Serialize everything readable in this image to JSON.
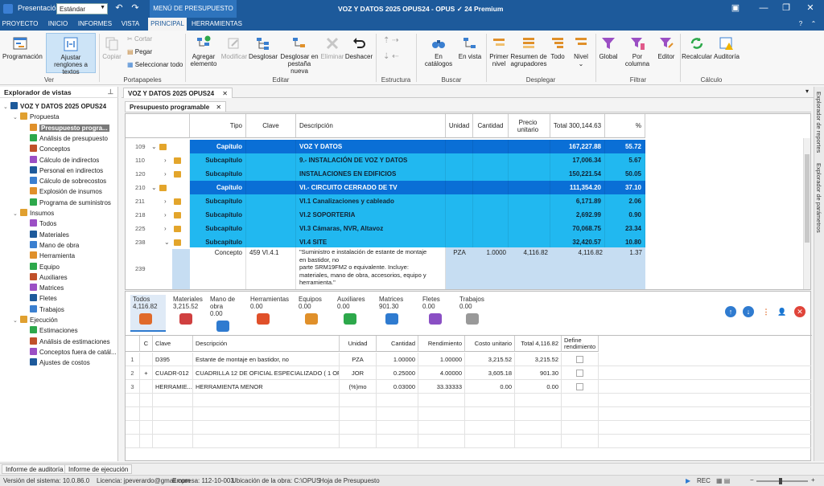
{
  "titlebar": {
    "presentation_label": "Presentación:",
    "presentation_value": "Estándar",
    "context_menu": "MENÚ DE PRESUPUESTO",
    "title": "VOZ Y DATOS 2025 OPUS24 - OPUS ✓ 24 Premium"
  },
  "menu_tabs": [
    "PROYECTO",
    "INICIO",
    "INFORMES",
    "VISTA",
    "PRINCIPAL",
    "HERRAMIENTAS"
  ],
  "ribbon": {
    "programacion": "Programación",
    "ajustar": "Ajustar renglones a textos",
    "copiar": "Copiar",
    "cortar": "Cortar",
    "pegar": "Pegar",
    "seleccionar": "Seleccionar todo",
    "agregar": "Agregar elemento",
    "modificar": "Modificar",
    "desglosar": "Desglosar",
    "desglosar_pestana": "Desglosar en pestaña nueva",
    "eliminar": "Eliminar",
    "deshacer": "Deshacer",
    "en_catalogos": "En catálogos",
    "en_vista": "En vista",
    "primer_nivel": "Primer nivel",
    "resumen": "Resumen de agrupadores",
    "todo": "Todo",
    "nivel": "Nivel",
    "global": "Global",
    "por_columna": "Por columna",
    "editor": "Editor",
    "recalcular": "Recalcular",
    "auditoria": "Auditoría",
    "groups": {
      "ver": "Ver",
      "portapapeles": "Portapapeles",
      "editar": "Editar",
      "estructura": "Estructura",
      "buscar": "Buscar",
      "desplegar": "Desplegar",
      "filtrar": "Filtrar",
      "calculo": "Cálculo"
    }
  },
  "left_panel": {
    "title": "Explorador de vistas",
    "items": [
      {
        "label": "VOZ Y DATOS 2025 OPUS24",
        "level": 0,
        "bold": true
      },
      {
        "label": "Propuesta",
        "level": 1
      },
      {
        "label": "Presupuesto progra...",
        "level": 2,
        "selected": true
      },
      {
        "label": "Análisis de presupuesto",
        "level": 2
      },
      {
        "label": "Conceptos",
        "level": 2
      },
      {
        "label": "Cálculo de indirectos",
        "level": 2
      },
      {
        "label": "Personal en indirectos",
        "level": 2
      },
      {
        "label": "Cálculo de sobrecostos",
        "level": 2
      },
      {
        "label": "Explosión de insumos",
        "level": 2
      },
      {
        "label": "Programa de suministros",
        "level": 2
      },
      {
        "label": "Insumos",
        "level": 1
      },
      {
        "label": "Todos",
        "level": 2
      },
      {
        "label": "Materiales",
        "level": 2
      },
      {
        "label": "Mano de obra",
        "level": 2
      },
      {
        "label": "Herramienta",
        "level": 2
      },
      {
        "label": "Equipo",
        "level": 2
      },
      {
        "label": "Auxiliares",
        "level": 2
      },
      {
        "label": "Matrices",
        "level": 2
      },
      {
        "label": "Fletes",
        "level": 2
      },
      {
        "label": "Trabajos",
        "level": 2
      },
      {
        "label": "Ejecución",
        "level": 1
      },
      {
        "label": "Estimaciones",
        "level": 2
      },
      {
        "label": "Análisis de estimaciones",
        "level": 2
      },
      {
        "label": "Conceptos fuera de catál...",
        "level": 2
      },
      {
        "label": "Ajustes de costos",
        "level": 2
      }
    ]
  },
  "doc_tab": "VOZ Y DATOS 2025 OPUS24",
  "sub_tab": "Presupuesto programable",
  "side_tabs": [
    "Explorador de reportes",
    "Explorador de parámetros"
  ],
  "grid": {
    "headers": {
      "tipo": "Tipo",
      "clave": "Clave",
      "descripcion": "Descripción",
      "unidad": "Unidad",
      "cantidad": "Cantidad",
      "precio": "Precio unitario",
      "total": "Total 300,144.63",
      "pct": "%"
    },
    "rows": [
      {
        "num": "109",
        "exp": "⌄",
        "tipo": "Capítulo",
        "clave": "",
        "desc": "VOZ Y DATOS",
        "unidad": "",
        "cantidad": "",
        "precio": "",
        "total": "167,227.88",
        "pct": "55.72",
        "kind": "cap"
      },
      {
        "num": "110",
        "exp": "›",
        "tipo": "Subcapítulo",
        "clave": "",
        "desc": "9.- INSTALACIÓN DE VOZ Y DATOS",
        "unidad": "",
        "cantidad": "",
        "precio": "",
        "total": "17,006.34",
        "pct": "5.67",
        "kind": "sub"
      },
      {
        "num": "120",
        "exp": "›",
        "tipo": "Subcapítulo",
        "clave": "",
        "desc": "INSTALACIONES EN EDIFICIOS",
        "unidad": "",
        "cantidad": "",
        "precio": "",
        "total": "150,221.54",
        "pct": "50.05",
        "kind": "sub"
      },
      {
        "num": "210",
        "exp": "⌄",
        "tipo": "Capítulo",
        "clave": "",
        "desc": "VI.-   CIRCUITO CERRADO DE TV",
        "unidad": "",
        "cantidad": "",
        "precio": "",
        "total": "111,354.20",
        "pct": "37.10",
        "kind": "cap"
      },
      {
        "num": "211",
        "exp": "›",
        "tipo": "Subcapítulo",
        "clave": "",
        "desc": "VI.1  Canalizaciones y cableado",
        "unidad": "",
        "cantidad": "",
        "precio": "",
        "total": "6,171.89",
        "pct": "2.06",
        "kind": "sub"
      },
      {
        "num": "218",
        "exp": "›",
        "tipo": "Subcapítulo",
        "clave": "",
        "desc": "VI.2  SOPORTERIA",
        "unidad": "",
        "cantidad": "",
        "precio": "",
        "total": "2,692.99",
        "pct": "0.90",
        "kind": "sub"
      },
      {
        "num": "225",
        "exp": "›",
        "tipo": "Subcapítulo",
        "clave": "",
        "desc": "VI.3  Cámaras, NVR, Altavoz",
        "unidad": "",
        "cantidad": "",
        "precio": "",
        "total": "70,068.75",
        "pct": "23.34",
        "kind": "sub"
      },
      {
        "num": "238",
        "exp": "⌄",
        "tipo": "Subcapítulo",
        "clave": "",
        "desc": "VI.4  SITE",
        "unidad": "",
        "cantidad": "",
        "precio": "",
        "total": "32,420.57",
        "pct": "10.80",
        "kind": "sub"
      }
    ],
    "concept": {
      "num": "239",
      "tipo": "Concepto",
      "clave": "459   VI.4.1",
      "desc1": "\"Suministro e instalación de estante de montaje",
      "desc2": "en bastidor, no",
      "desc3": "parte SRM19FM2 o equivalente. Incluye:",
      "desc4": "materiales, mano de obra, accesorios, equipo y",
      "desc5": "herramienta.\"",
      "unidad": "PZA",
      "cantidad": "1.0000",
      "precio": "4,116.82",
      "total": "4,116.82",
      "pct": "1.37"
    }
  },
  "ins_tabs": [
    {
      "label": "Todos",
      "value": "4,116.82"
    },
    {
      "label": "Materiales",
      "value": "3,215.52"
    },
    {
      "label": "Mano de obra",
      "value": "0.00"
    },
    {
      "label": "Herramientas",
      "value": "0.00"
    },
    {
      "label": "Equipos",
      "value": "0.00"
    },
    {
      "label": "Auxiliares",
      "value": "0.00"
    },
    {
      "label": "Matrices",
      "value": "901.30"
    },
    {
      "label": "Fletes",
      "value": "0.00"
    },
    {
      "label": "Trabajos",
      "value": "0.00"
    }
  ],
  "ins_grid": {
    "headers": {
      "c": "C",
      "clave": "Clave",
      "desc": "Descripción",
      "unidad": "Unidad",
      "cantidad": "Cantidad",
      "rend": "Rendimiento",
      "costo": "Costo unitario",
      "total": "Total 4,116.82",
      "define": "Define rendimiento"
    },
    "rows": [
      {
        "n": "1",
        "exp": "",
        "clave": "D395",
        "desc": "Estante de montaje en bastidor, no",
        "unidad": "PZA",
        "cantidad": "1.00000",
        "rend": "1.00000",
        "costo": "3,215.52",
        "total": "3,215.52"
      },
      {
        "n": "2",
        "exp": "+",
        "clave": "CUADR-012",
        "desc": "CUADRILLA 12 DE OFICIAL ESPECIALIZADO ( 1 OFI",
        "unidad": "JOR",
        "cantidad": "0.25000",
        "rend": "4.00000",
        "costo": "3,605.18",
        "total": "901.30"
      },
      {
        "n": "3",
        "exp": "",
        "clave": "HERRAMIE...",
        "desc": "HERRAMIENTA MENOR",
        "unidad": "(%)mo",
        "cantidad": "0.03000",
        "rend": "33.33333",
        "costo": "0.00",
        "total": "0.00"
      }
    ]
  },
  "bottom_tabs": [
    "Informe de auditoría",
    "Informe de ejecución"
  ],
  "status": {
    "version": "Versión del sistema: 10.0.86.0",
    "licencia": "Licencia: jpeverardo@gmail.com",
    "empresa": "Empresa: 112-10-003",
    "ubicacion": "Ubicación de la obra: C:\\OPUS",
    "hoja": "Hoja de Presupuesto",
    "rec": "REC"
  },
  "colors": {
    "accent": "#1d5a9b",
    "capitulo": "#0a6fd6",
    "subcapitulo": "#21b8f0",
    "concept_cell": "#c6ddf2"
  }
}
